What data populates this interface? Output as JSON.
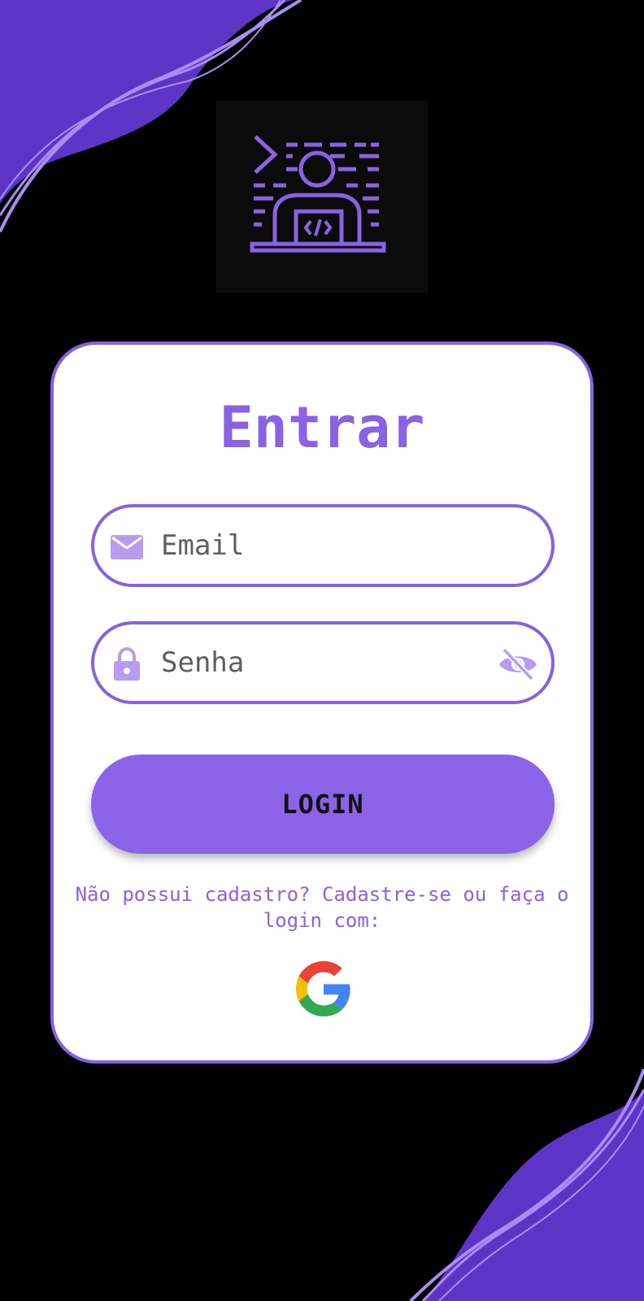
{
  "colors": {
    "background": "#000000",
    "accent": "#8a63e4",
    "accent_dark": "#5c35c7",
    "wave_line": "#a98df0",
    "card": "#ffffff"
  },
  "login": {
    "title": "Entrar",
    "email_placeholder": "Email",
    "password_placeholder": "Senha",
    "button_label": "LOGIN",
    "register_text": "Não possui cadastro? Cadastre-se ou faça o login com:"
  },
  "icons": {
    "logo": "developer-laptop-icon",
    "email": "envelope-icon",
    "password": "lock-icon",
    "toggle_password": "eye-off-icon",
    "social": "google-icon"
  }
}
